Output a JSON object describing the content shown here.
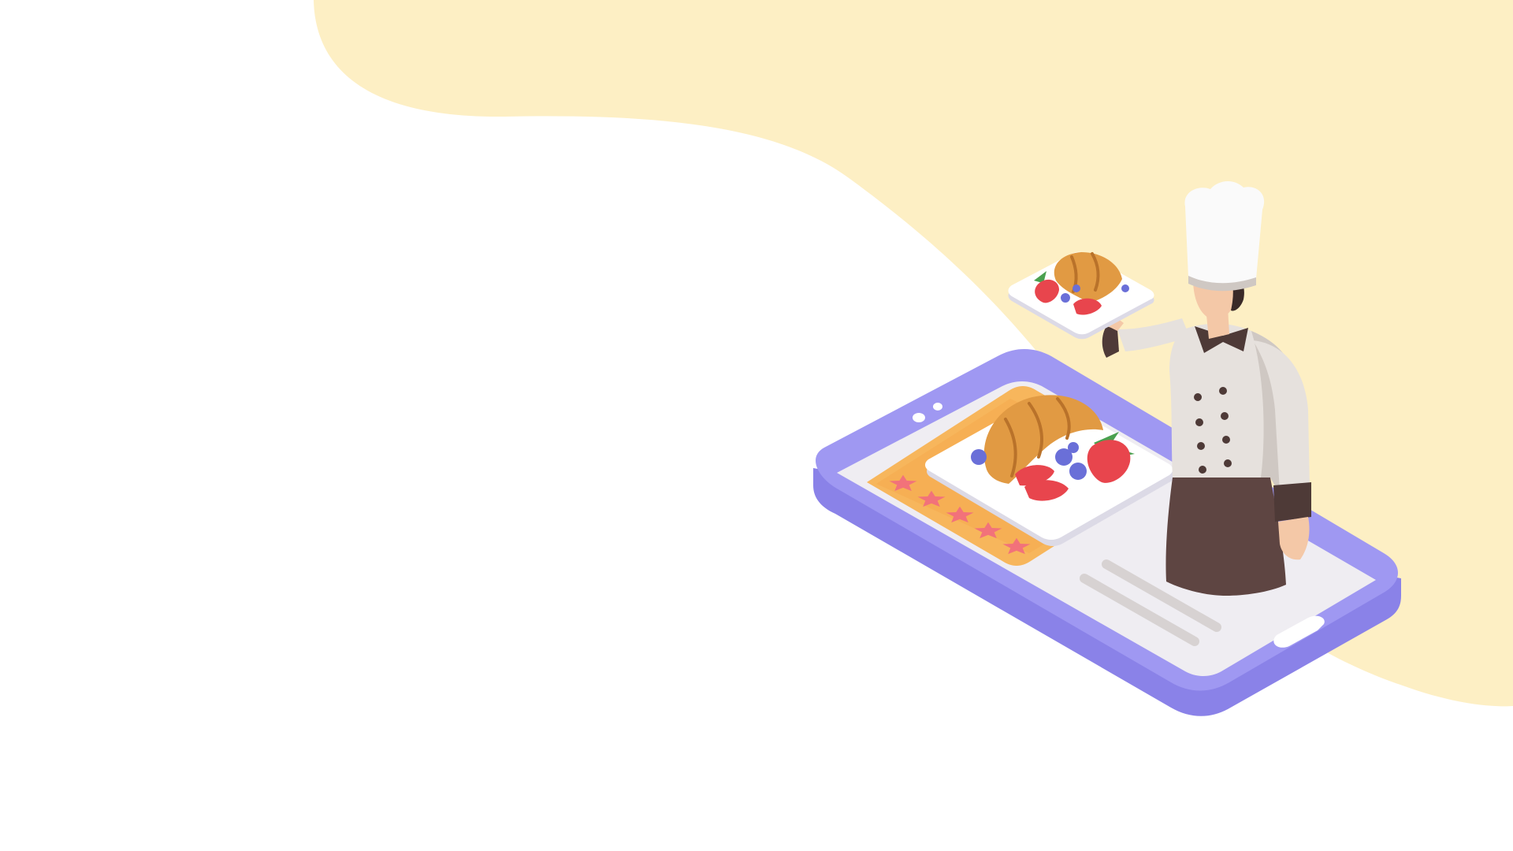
{
  "scene": {
    "subject": "chef-with-food-delivery-phone",
    "rating_stars": 5,
    "colors": {
      "page_background": "#ffffff",
      "blob": "#fdefc4",
      "phone_body": "#9f98f2",
      "phone_body_dark": "#8a82e8",
      "phone_screen": "#efedf2",
      "card": "#f7b65c",
      "card_inner": "#f29a3c",
      "star": "#f2727a",
      "plate": "#ffffff",
      "plate_shadow": "#dcdae6",
      "croissant": "#e19a43",
      "croissant_dark": "#b9722a",
      "strawberry": "#e8454d",
      "leaf": "#4aa04f",
      "blueberry": "#6a6fd8",
      "text_line": "#d7d2d2",
      "chef_jacket": "#e6e1dd",
      "chef_jacket_shadow": "#cfc8c3",
      "chef_trim": "#4e3a37",
      "apron": "#5e4542",
      "skin": "#f4c8a7",
      "hair": "#3a2a28",
      "hat": "#fafafa"
    },
    "icons": [
      "phone-icon",
      "chef-icon",
      "plate-icon",
      "croissant-icon",
      "strawberry-icon",
      "blueberry-icon",
      "star-icon"
    ]
  }
}
